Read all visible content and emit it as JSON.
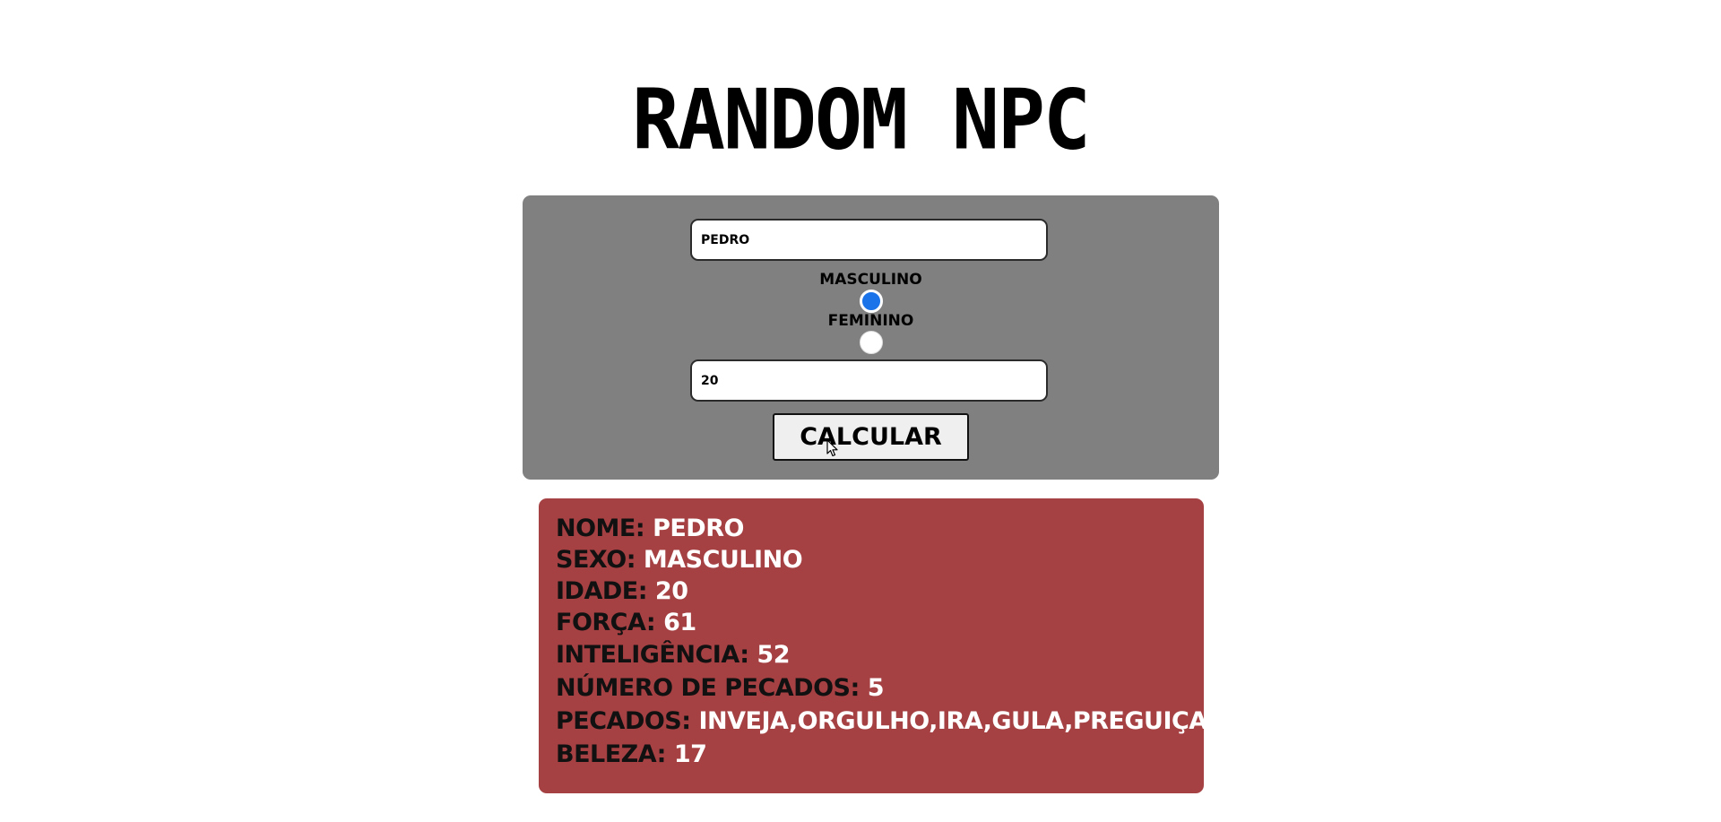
{
  "page": {
    "title": "RANDOM NPC"
  },
  "form": {
    "name_value": "PEDRO",
    "gender_options": [
      {
        "label": "MASCULINO",
        "selected": true
      },
      {
        "label": "FEMININO",
        "selected": false
      }
    ],
    "age_value": "20",
    "calculate_label": "CALCULAR"
  },
  "result": {
    "rows": [
      {
        "key": "NOME:",
        "value": "PEDRO"
      },
      {
        "key": "SEXO:",
        "value": "MASCULINO"
      },
      {
        "key": "IDADE:",
        "value": "20"
      },
      {
        "key": "FORçA:",
        "value": "61"
      },
      {
        "key": "INTELIGêNCIA:",
        "value": "52"
      },
      {
        "key": "NúMERO DE PECADOS:",
        "value": "5"
      },
      {
        "key": "PECADOS:",
        "value": "INVEJA,ORGULHO,IRA,GULA,PREGUIçA"
      },
      {
        "key": "BELEZA:",
        "value": "17"
      }
    ]
  },
  "colors": {
    "form_panel_bg": "#808080",
    "result_panel_bg": "#a54043",
    "radio_selected": "#1a73e8"
  },
  "icons": {
    "cursor": "mouse-pointer-icon"
  }
}
